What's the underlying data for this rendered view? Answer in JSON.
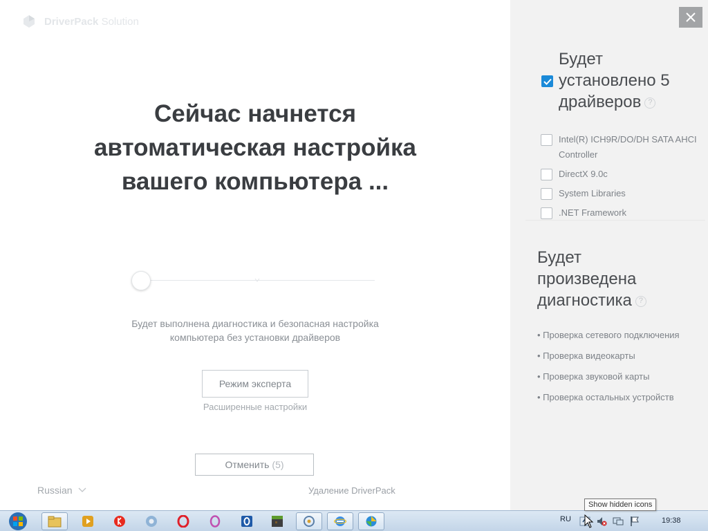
{
  "app": {
    "brand_bold": "DriverPack",
    "brand_light": "Solution"
  },
  "main": {
    "headline_line1": "Сейчас начнется",
    "headline_line2": "автоматическая настройка",
    "headline_line3": "вашего компьютера ...",
    "desc_line1": "Будет выполнена диагностика и безопасная настройка",
    "desc_line2": "компьютера без установки драйверов",
    "expert_button": "Режим эксперта",
    "advanced_settings": "Расширенные настройки",
    "cancel_label": "Отменить",
    "cancel_count": "(5)",
    "language": "Russian",
    "uninstall": "Удаление DriverPack"
  },
  "side": {
    "drivers_title_line1": "Будет",
    "drivers_title_line2": "установлено 5",
    "drivers_title_line3": "драйверов",
    "help_glyph": "?",
    "drivers": [
      {
        "label": "Intel(R) ICH9R/DO/DH SATA AHCI Controller"
      },
      {
        "label": "DirectX 9.0c"
      },
      {
        "label": "System Libraries"
      },
      {
        "label": ".NET Framework"
      }
    ],
    "diag_title_line1": "Будет",
    "diag_title_line2": "произведена",
    "diag_title_line3": "диагностика",
    "diagnostics": [
      "• Проверка сетевого подключения",
      "• Проверка видеокарты",
      "• Проверка звуковой карты",
      "• Проверка остальных устройств"
    ]
  },
  "taskbar": {
    "lang": "RU",
    "clock": "19:38",
    "tooltip": "Show hidden icons"
  },
  "colors": {
    "accent": "#1b8ad8",
    "side_bg": "#f2f2f2",
    "headline": "#3a3d41"
  }
}
